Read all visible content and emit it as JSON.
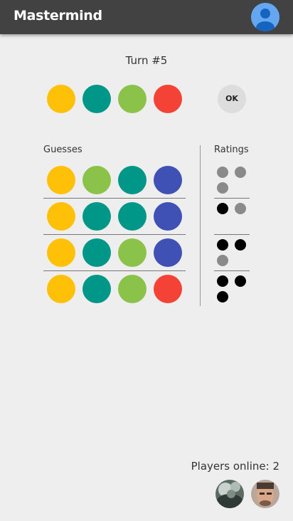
{
  "app": {
    "title": "Mastermind",
    "account_icon": "account-circle-icon"
  },
  "colors": {
    "yellow": "#ffc107",
    "teal": "#009688",
    "green": "#8bc34a",
    "red": "#f44336",
    "indigo": "#3f51b5",
    "header": "#424242",
    "background": "#eeeeee"
  },
  "turn": {
    "label": "Turn #5"
  },
  "current_guess": [
    "yellow",
    "teal",
    "green",
    "red"
  ],
  "ok_button": {
    "label": "OK"
  },
  "board": {
    "guesses_header": "Guesses",
    "ratings_header": "Ratings",
    "rows": [
      {
        "pegs": [
          "yellow",
          "green",
          "teal",
          "indigo"
        ],
        "black": 0,
        "white": 3
      },
      {
        "pegs": [
          "yellow",
          "teal",
          "teal",
          "indigo"
        ],
        "black": 1,
        "white": 1
      },
      {
        "pegs": [
          "yellow",
          "teal",
          "green",
          "indigo"
        ],
        "black": 2,
        "white": 1
      },
      {
        "pegs": [
          "yellow",
          "teal",
          "green",
          "red"
        ],
        "black": 3,
        "white": 0
      }
    ]
  },
  "players": {
    "label": "Players online: 2",
    "avatars": [
      "player-avatar-1",
      "player-avatar-2"
    ]
  }
}
